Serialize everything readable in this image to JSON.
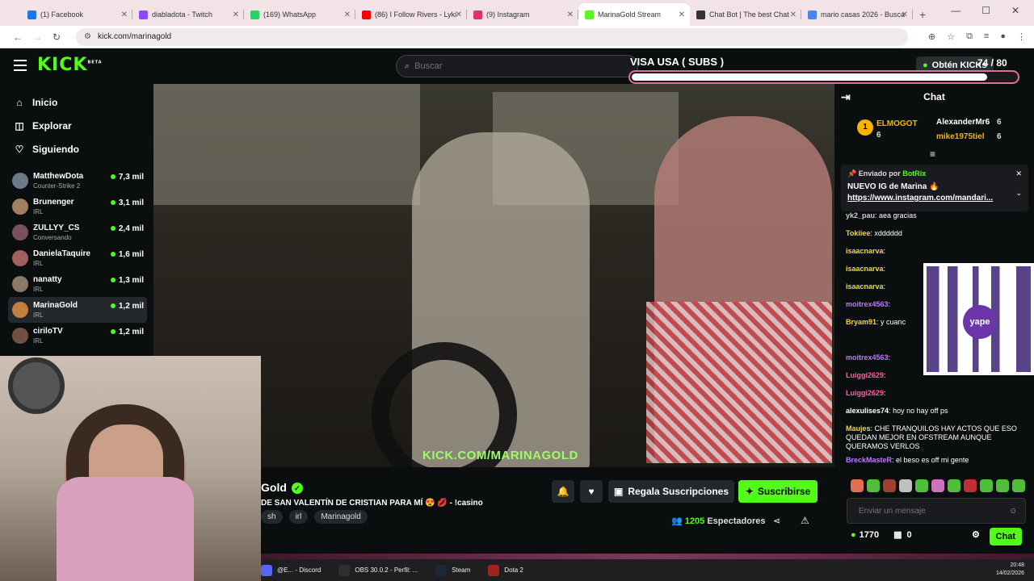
{
  "browser": {
    "tabs": [
      {
        "title": "(1) Facebook",
        "color": "#1877f2"
      },
      {
        "title": "diabladota - Twitch",
        "color": "#9146ff"
      },
      {
        "title": "(169) WhatsApp",
        "color": "#25d366"
      },
      {
        "title": "(86) I Follow Rivers - Lyki",
        "color": "#ff0000"
      },
      {
        "title": "(9) Instagram",
        "color": "#e1306c"
      },
      {
        "title": "MarinaGold Stream",
        "color": "#53fc18"
      },
      {
        "title": "Chat Bot | The best Chat",
        "color": "#333333"
      },
      {
        "title": "mario casas 2026 - Busca",
        "color": "#4285f4"
      }
    ],
    "active_tab": 5,
    "url": "kick.com/marinagold"
  },
  "kick": {
    "logo": "KICK",
    "logo_badge": "BETA",
    "search_placeholder": "Buscar",
    "overlay_title": "VISA USA ( SUBS )",
    "overlay_count": "74 / 80",
    "overlay_progress": 0.925,
    "get_kicks": "Obtén KICKs"
  },
  "sidebar": {
    "nav": [
      {
        "label": "Inicio",
        "icon": "home-icon",
        "glyph": "⌂"
      },
      {
        "label": "Explorar",
        "icon": "compass-icon",
        "glyph": "◫"
      },
      {
        "label": "Siguiendo",
        "icon": "heart-icon",
        "glyph": "♡"
      }
    ],
    "channels": [
      {
        "name": "MatthewDota",
        "category": "Counter-Strike 2",
        "viewers": "7,3 mil",
        "color": "#6b7a8a"
      },
      {
        "name": "Brunenger",
        "category": "IRL",
        "viewers": "3,1 mil",
        "color": "#a08060"
      },
      {
        "name": "ZULLYY_CS",
        "category": "Conversando",
        "viewers": "2,4 mil",
        "color": "#7a5060"
      },
      {
        "name": "DanielaTaquire",
        "category": "IRL",
        "viewers": "1,6 mil",
        "color": "#a06060"
      },
      {
        "name": "nanatty",
        "category": "IRL",
        "viewers": "1,3 mil",
        "color": "#8a7a6a"
      },
      {
        "name": "MarinaGold",
        "category": "IRL",
        "viewers": "1,2 mil",
        "color": "#c08040",
        "selected": true
      },
      {
        "name": "ciriloTV",
        "category": "IRL",
        "viewers": "1,2 mil",
        "color": "#705040"
      }
    ]
  },
  "video": {
    "watermark": "KICK.COM/MARINAGOLD"
  },
  "stream": {
    "name": "Gold",
    "title": "DE SAN VALENTÍN DE CRISTIAN PARA MÍ 😍 💋 - !casino",
    "tags": [
      "sh",
      "irl",
      "Marinagold"
    ],
    "gift_label": "Regala Suscripciones",
    "subscribe_label": "Suscribirse",
    "viewers_count": "1205",
    "viewers_label": "Espectadores"
  },
  "chat": {
    "title": "Chat",
    "leaders": [
      {
        "rank": "1",
        "name": "ELMOGOT",
        "count": "6"
      },
      {
        "name": "AlexanderMr6",
        "count": "6"
      },
      {
        "name": "mike1975tiel",
        "count": "6"
      }
    ],
    "pinned": {
      "sent_by": "Enviado por",
      "bot": "BotRix",
      "line1": "NUEVO IG de Marina 🔥",
      "line2": "https://www.instagram.com/mandari..."
    },
    "messages": [
      {
        "user": "yk2_pau",
        "text": "aea gracias",
        "color": "#cccccc"
      },
      {
        "user": "Tokiiee",
        "text": "xdddddd",
        "color": "#f5d547"
      },
      {
        "user": "isaacnarva",
        "text": "",
        "color": "#f5d547"
      },
      {
        "user": "isaacnarva",
        "text": "",
        "color": "#f5d547"
      },
      {
        "user": "isaacnarva",
        "text": "",
        "color": "#f5d547"
      },
      {
        "user": "moitrex4563",
        "text": "",
        "color": "#b57cff"
      },
      {
        "user": "Bryam91",
        "text": "y cuanc",
        "color": "#f5d547"
      },
      {
        "user": "",
        "text": "",
        "color": "#ffffff"
      },
      {
        "user": "moitrex4563",
        "text": "",
        "color": "#b57cff"
      },
      {
        "user": "Luiggi2629",
        "text": "",
        "color": "#ff5fa2"
      },
      {
        "user": "Luiggi2629",
        "text": "",
        "color": "#ff5fa2"
      },
      {
        "user": "alexulises74",
        "text": "hoy no hay off ps",
        "color": "#ffffff"
      },
      {
        "user": "Maujes",
        "text": "CHE TRANQUILOS HAY ACTOS QUE ESO QUEDAN MEJOR EN OFSTREAM AUNQUE QUERAMOS VERLOS",
        "color": "#f5d547"
      },
      {
        "user": "BreckMasteR",
        "text": "el beso es off mi gente",
        "color": "#b57cff"
      }
    ],
    "qr_label": "yape",
    "input_placeholder": "Enviar un mensaje",
    "points": "1770",
    "gifts": "0",
    "send_label": "Chat"
  },
  "taskbar": {
    "items": [
      {
        "label": "@E... - Discord",
        "color": "#5865f2"
      },
      {
        "label": "OBS 30.0.2 - Perfil: ...",
        "color": "#302e31"
      },
      {
        "label": "Steam",
        "color": "#1b2838"
      },
      {
        "label": "Dota 2",
        "color": "#a0231b"
      }
    ],
    "time": "20:48",
    "date": "14/02/2026"
  }
}
